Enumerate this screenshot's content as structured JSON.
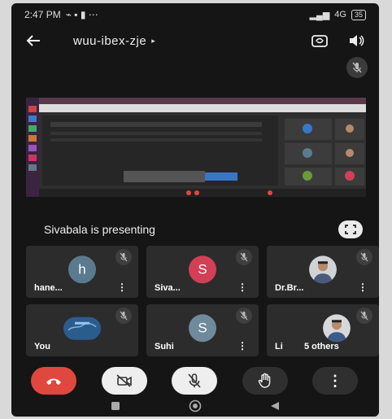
{
  "status_bar": {
    "time": "2:47 PM",
    "signal_text": "4G",
    "battery": "35"
  },
  "header": {
    "title": "wuu-ibex-zje"
  },
  "presentation": {
    "presenter_text": "Sivabala is presenting"
  },
  "participants": [
    {
      "name": "hane...",
      "initial": "h",
      "avatar_color": "#5a7b8f",
      "kind": "initial"
    },
    {
      "name": "Siva...",
      "initial": "S",
      "avatar_color": "#d23f56",
      "kind": "initial"
    },
    {
      "name": "Dr.Br...",
      "initial": "",
      "avatar_color": "#8a6a50",
      "kind": "photo"
    },
    {
      "name": "You",
      "initial": "",
      "avatar_color": "#2b5c8e",
      "kind": "self"
    },
    {
      "name": "Suhi",
      "initial": "S",
      "avatar_color": "#6f8a9a",
      "kind": "initial"
    },
    {
      "name": "Li",
      "initial": "",
      "avatar_color": "#8a6a50",
      "kind": "photo",
      "others": "5 others"
    }
  ],
  "colors": {
    "end_call": "#e0473e",
    "control_light": "#eeeeee",
    "control_dark": "#2f2f2f",
    "tile": "#2c2c2c"
  }
}
